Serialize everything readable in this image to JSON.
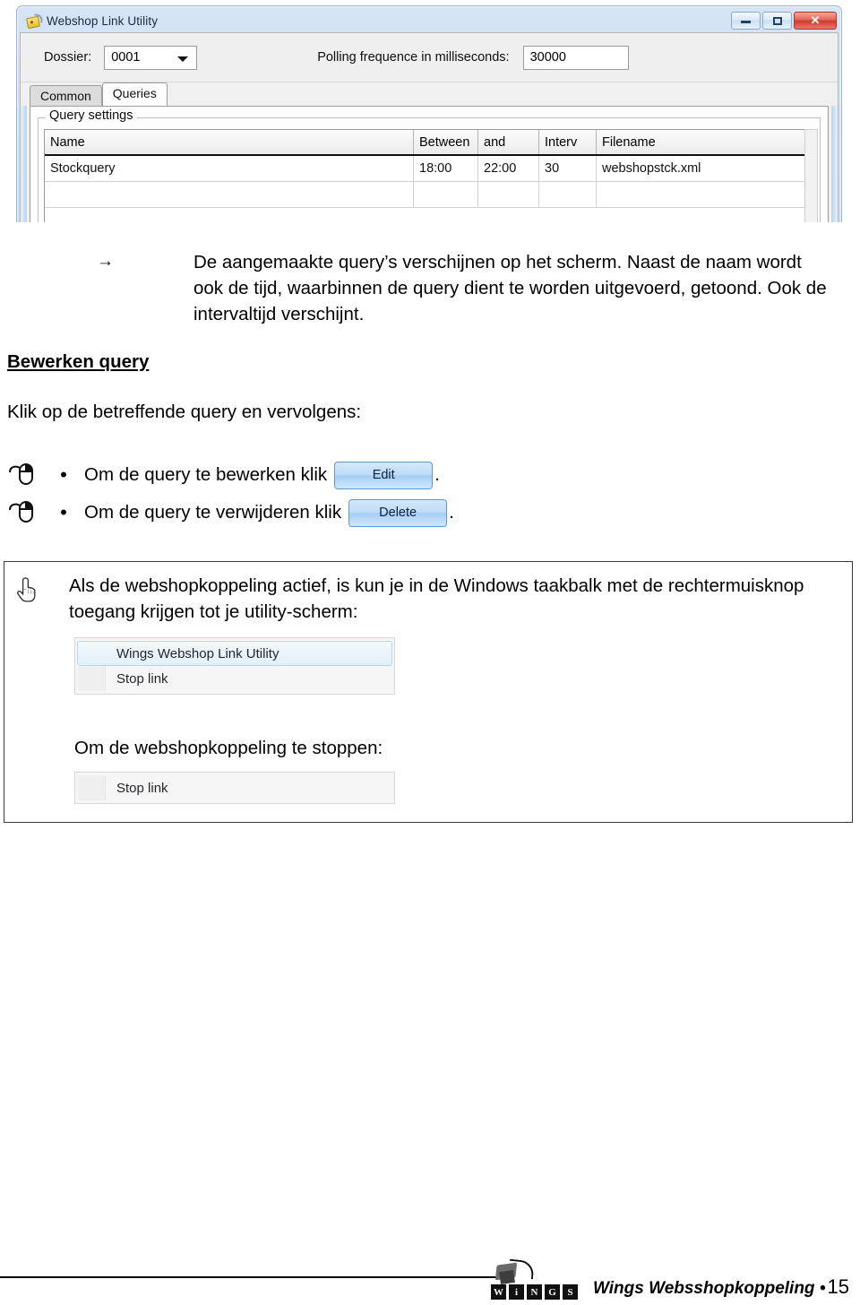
{
  "screenshot": {
    "window_title": "Webshop Link Utility",
    "title_icon": "tag-icon",
    "window_buttons": {
      "minimize": "minimize-icon",
      "maximize": "maximize-icon",
      "close": "✕"
    },
    "form": {
      "dossier_label": "Dossier:",
      "dossier_value": "0001",
      "polling_label": "Polling frequence in milliseconds:",
      "polling_value": "30000"
    },
    "tabs": [
      {
        "label": "Common",
        "active": false
      },
      {
        "label": "Queries",
        "active": true
      }
    ],
    "group_legend": "Query settings",
    "grid": {
      "headers": [
        "Name",
        "Between",
        "and",
        "Interv",
        "Filename"
      ],
      "rows": [
        [
          "Stockquery",
          "18:00",
          "22:00",
          "30",
          "webshopstck.xml"
        ]
      ]
    }
  },
  "body": {
    "arrow_glyph": "→",
    "arrow_paragraph": "De aangemaakte query’s verschijnen op het scherm.  Naast de naam wordt ook de tijd, waarbinnen de query dient te worden uitgevoerd, getoond.  Ook de intervaltijd verschijnt.",
    "heading_bewerken": "Bewerken query",
    "intro": "Klik op de betreffende query en vervolgens:",
    "bullets": [
      {
        "icon": "mouse-icon",
        "dot": "•",
        "text": "Om de query te bewerken klik",
        "button": "Edit",
        "tail": "."
      },
      {
        "icon": "mouse-icon",
        "dot": "•",
        "text": "Om de query te verwijderen klik",
        "button": "Delete",
        "tail": "."
      }
    ],
    "note": {
      "icon": "pointing-hand-icon",
      "text": "Als de webshopkoppeling actief, is kun je in de Windows taakbalk met de rechtermuisknop toegang krijgen tot je utility-scherm:",
      "menu1": [
        {
          "label": "Wings Webshop Link Utility",
          "highlighted": true
        },
        {
          "label": "Stop link",
          "highlighted": false
        }
      ],
      "subtext": "Om de webshopkoppeling te stoppen:",
      "menu2": [
        {
          "label": "Stop link",
          "highlighted": false
        }
      ]
    }
  },
  "footer": {
    "logo_letters": [
      "W",
      "i",
      "N",
      "G",
      "S"
    ],
    "text": "Wings Websshopkoppeling •",
    "page": "15"
  }
}
